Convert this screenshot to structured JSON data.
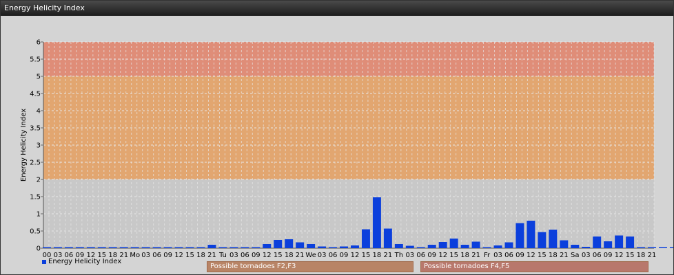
{
  "window": {
    "title": "Energy Helicity Index"
  },
  "colors": {
    "bar": "#0b3fdc",
    "plot_background": "#c8c8c8",
    "zone_low": "#e4a46c",
    "zone_high": "#e08a74",
    "grid": "#e8e8e8"
  },
  "chart_data": {
    "type": "bar",
    "ylabel": "Energy Helicity Index",
    "ylim": [
      0,
      6
    ],
    "yticks": [
      "0",
      "0.5",
      "1",
      "1.5",
      "2",
      "2.5",
      "3",
      "3.5",
      "4",
      "4.5",
      "5",
      "5.5",
      "6"
    ],
    "grid": true,
    "categories": [
      "00",
      "03",
      "06",
      "09",
      "12",
      "15",
      "18",
      "21",
      "Mo",
      "03",
      "06",
      "09",
      "12",
      "15",
      "18",
      "21",
      "Tu",
      "03",
      "06",
      "09",
      "12",
      "15",
      "18",
      "21",
      "We",
      "03",
      "06",
      "09",
      "12",
      "15",
      "18",
      "21",
      "Th",
      "03",
      "06",
      "09",
      "12",
      "15",
      "18",
      "21",
      "Fr",
      "03",
      "06",
      "09",
      "12",
      "15",
      "18",
      "21",
      "Sa",
      "03",
      "06",
      "09",
      "12",
      "15",
      "18",
      "21"
    ],
    "series": [
      {
        "name": "Energy Helicity Index",
        "values": [
          0,
          0,
          0,
          0,
          0,
          0.02,
          0,
          0,
          0,
          0,
          0,
          0,
          0,
          0,
          0,
          0.1,
          0,
          0,
          0,
          0,
          0.12,
          0.24,
          0.26,
          0.17,
          0.12,
          0.05,
          0.03,
          0.05,
          0.08,
          0.55,
          1.48,
          0.57,
          0.12,
          0.07,
          0.02,
          0.1,
          0.18,
          0.28,
          0.1,
          0.19,
          0.03,
          0.08,
          0.17,
          0.73,
          0.8,
          0.47,
          0.54,
          0.23,
          0.1,
          0.04,
          0.34,
          0.2,
          0.37,
          0.34,
          0,
          0,
          0,
          0
        ]
      }
    ],
    "zones": [
      {
        "from": 2,
        "to": 5,
        "label": "Possible tornadoes F2,F3"
      },
      {
        "from": 5,
        "to": 6,
        "label": "Possible tornadoes F4,F5"
      }
    ],
    "legend_position": "bottom-left"
  }
}
